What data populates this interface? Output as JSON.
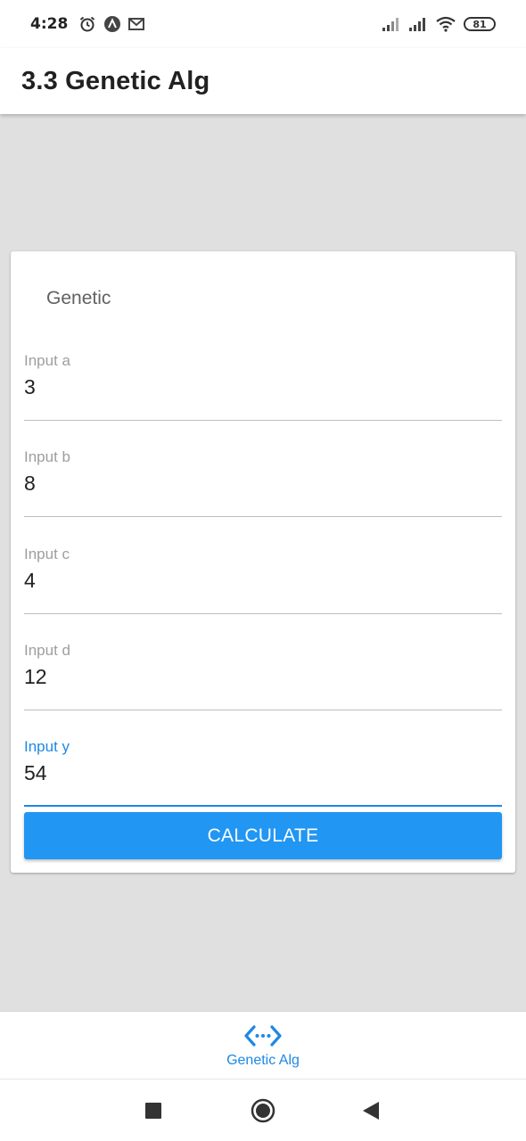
{
  "status_bar": {
    "time": "4:28",
    "battery": "81",
    "icons": [
      "alarm-icon",
      "app-notification-icon",
      "gmail-icon",
      "signal-icon",
      "signal-icon",
      "wifi-icon",
      "battery-icon"
    ]
  },
  "app_bar": {
    "title": "3.3 Genetic Alg"
  },
  "card": {
    "title": "Genetic",
    "fields": [
      {
        "label": "Input a",
        "value": "3"
      },
      {
        "label": "Input b",
        "value": "8"
      },
      {
        "label": "Input c",
        "value": "4"
      },
      {
        "label": "Input d",
        "value": "12"
      },
      {
        "label": "Input y",
        "value": "54"
      }
    ],
    "calculate_label": "CALCULATE"
  },
  "bottom_nav": {
    "label": "Genetic Alg",
    "icon": "code-arrows-icon"
  },
  "system_nav": {
    "icons": [
      "recents-icon",
      "home-icon",
      "back-icon"
    ]
  },
  "colors": {
    "accent": "#2196f3",
    "active_label": "#1e88e5",
    "background": "#e0e0e0"
  }
}
